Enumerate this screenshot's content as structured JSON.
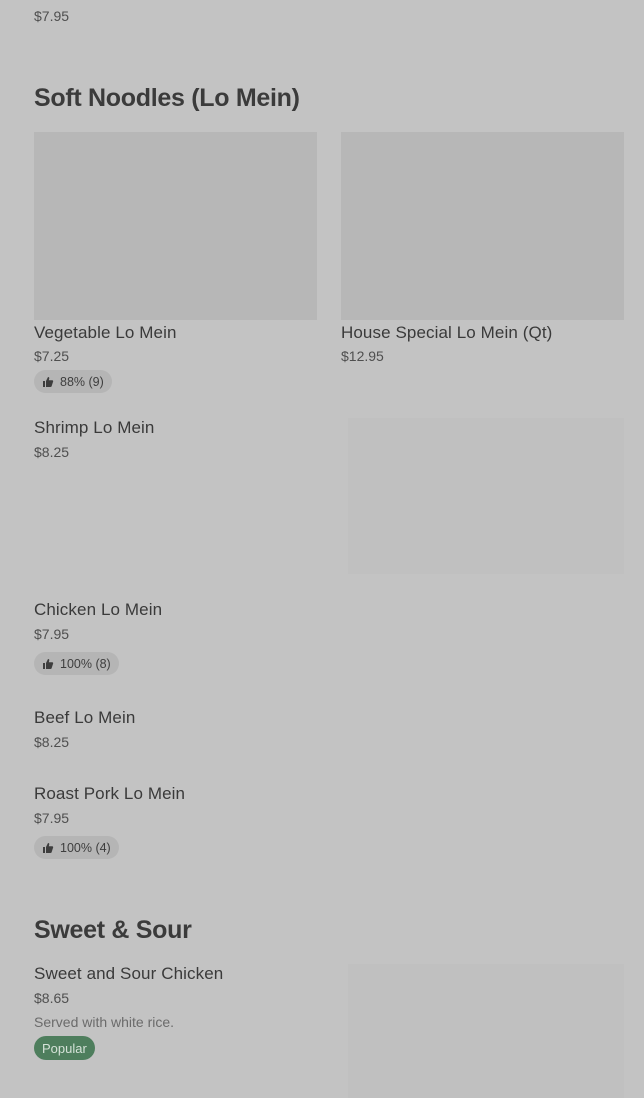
{
  "top_item": {
    "price": "$7.95"
  },
  "sections": [
    {
      "title": "Soft Noodles (Lo Mein)",
      "items": [
        {
          "name": "Vegetable Lo Mein",
          "price": "$7.25",
          "rating": "88% (9)"
        },
        {
          "name": "House Special Lo Mein (Qt)",
          "price": "$12.95"
        },
        {
          "name": "Shrimp Lo Mein",
          "price": "$8.25"
        },
        {
          "name": "Chicken Lo Mein",
          "price": "$7.95",
          "rating": "100% (8)"
        },
        {
          "name": "Beef Lo Mein",
          "price": "$8.25"
        },
        {
          "name": "Roast Pork Lo Mein",
          "price": "$7.95",
          "rating": "100% (4)"
        }
      ]
    },
    {
      "title": "Sweet & Sour",
      "items": [
        {
          "name": "Sweet and Sour Chicken",
          "price": "$8.65",
          "description": "Served with white rice.",
          "badge": "Popular"
        }
      ]
    }
  ],
  "icons": {
    "rating": "thumbs-up-icon"
  },
  "colors": {
    "background": "#c3c3c3",
    "popular_badge": "#4e7e5d"
  }
}
